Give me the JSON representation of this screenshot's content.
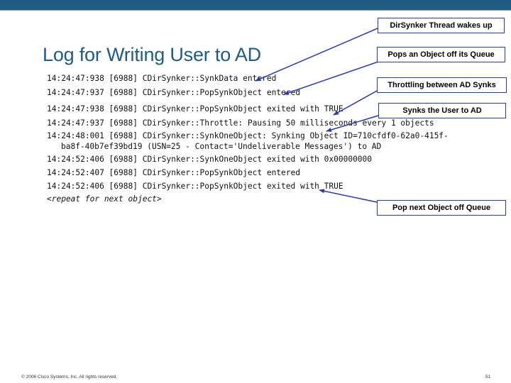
{
  "title": "Log for Writing User to AD",
  "log_lines": [
    "14:24:47:938 [6988] CDirSynker::SynkData entered",
    "14:24:47:937 [6988] CDirSynker::PopSynkObject entered",
    "14:24:47:938 [6988] CDirSynker::PopSynkObject exited with TRUE",
    "14:24:47:937 [6988] CDirSynker::Throttle: Pausing 50 milliseconds every 1 objects",
    "14:24:48:001 [6988] CDirSynker::SynkOneObject: Synking Object ID=710cfdf0-62a0-415f-",
    "ba8f-40b7ef39bd19 (USN=25 - Contact='Undeliverable Messages') to AD",
    "14:24:52:406 [6988] CDirSynker::SynkOneObject exited with 0x00000000",
    "14:24:52:407 [6988] CDirSynker::PopSynkObject entered",
    "14:24:52:406 [6988] CDirSynker::PopSynkObject exited with TRUE",
    "<repeat for next object>"
  ],
  "callouts": {
    "thread_wakes": "DirSynker Thread wakes up",
    "pops_object": "Pops an Object off its Queue",
    "throttling": "Throttling between AD Synks",
    "synks_user": "Synks the User to AD",
    "pop_next": "Pop next Object off Queue"
  },
  "footer": {
    "copyright": "© 2006 Cisco Systems, Inc. All rights reserved.",
    "page_number": "51"
  },
  "colors": {
    "header_bar": "#1f5c80",
    "title": "#1f5c80",
    "callout_border": "#2a3aa8",
    "arrow": "#2a3aa8"
  }
}
